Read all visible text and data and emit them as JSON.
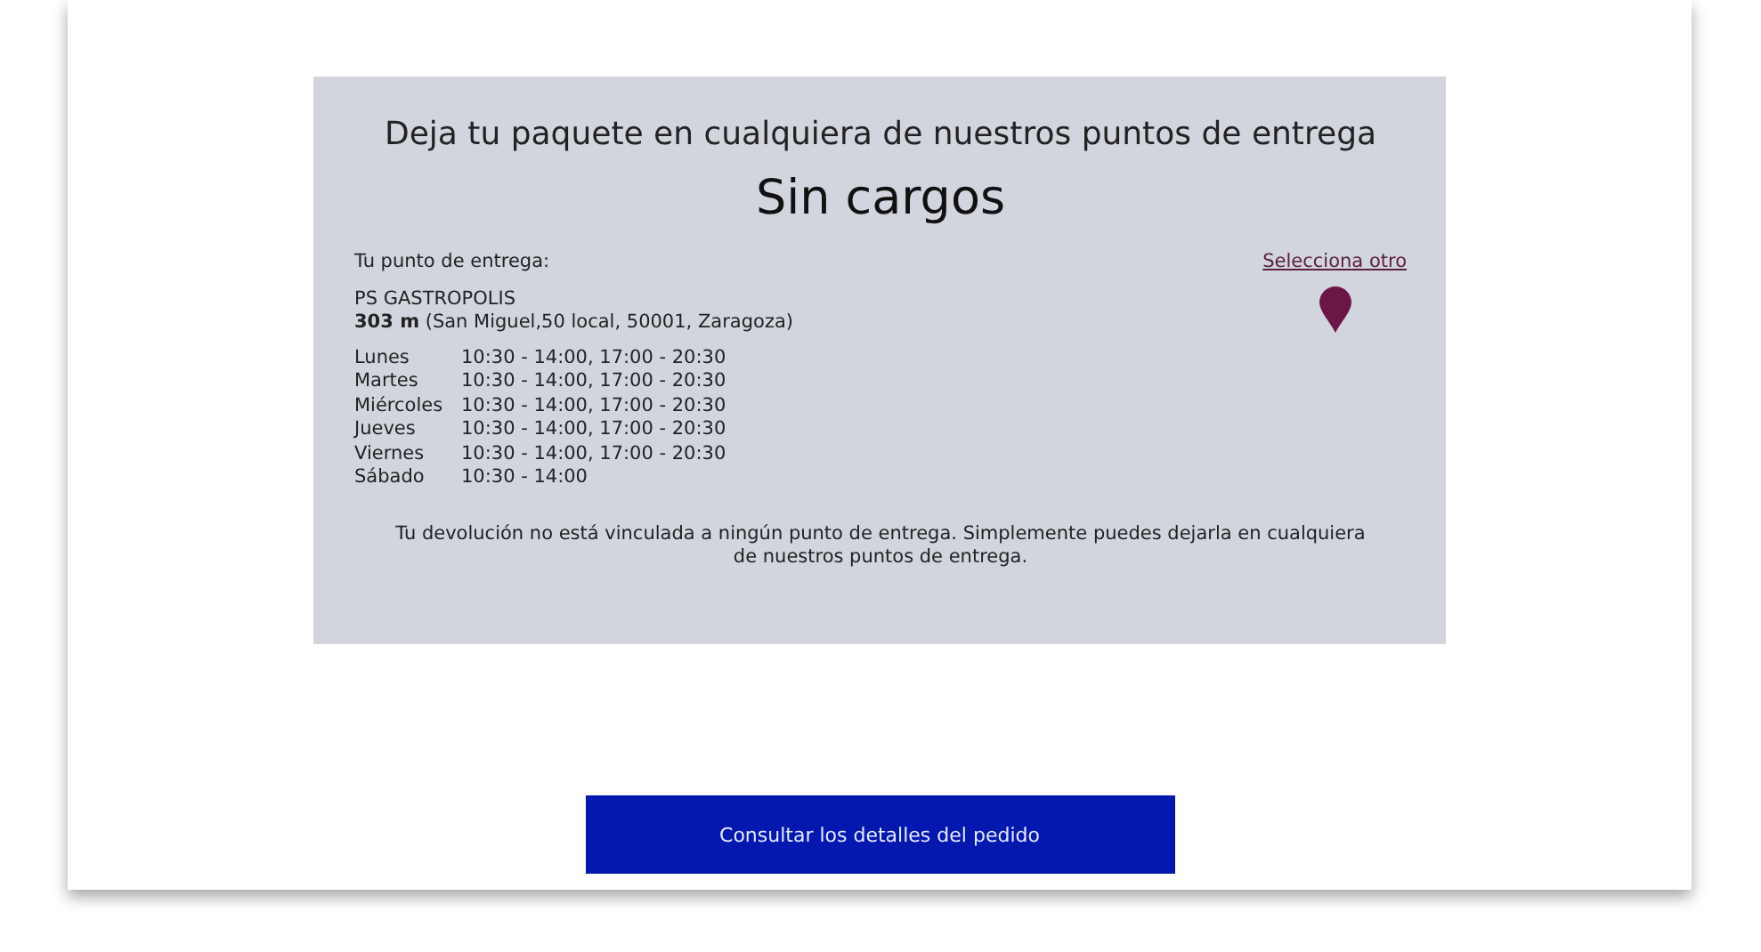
{
  "panel": {
    "heading": "Deja tu paquete en cualquiera de nuestros puntos de entrega",
    "price": "Sin cargos",
    "point_label": "Tu punto de entrega:",
    "change_link": "Selecciona otro",
    "point_name": "PS GASTROPOLIS",
    "point_address": "**303 m** (San Miguel,50 local, 50001, Zaragoza)",
    "hours": [
      {
        "day": "Lunes",
        "time": "10:30 - 14:00, 17:00 - 20:30"
      },
      {
        "day": "Martes",
        "time": "10:30 - 14:00, 17:00 - 20:30"
      },
      {
        "day": "Miércoles",
        "time": "10:30 - 14:00, 17:00 - 20:30"
      },
      {
        "day": "Jueves",
        "time": "10:30 - 14:00, 17:00 - 20:30"
      },
      {
        "day": "Viernes",
        "time": "10:30 - 14:00, 17:00 - 20:30"
      },
      {
        "day": "Sábado",
        "time": "10:30 - 14:00"
      }
    ],
    "note": "Tu devolución no está vinculada a ningún punto de entrega. Simplemente puedes dejarla en cualquiera de nuestros puntos de entrega."
  },
  "button": "Consultar los detalles del pedido"
}
